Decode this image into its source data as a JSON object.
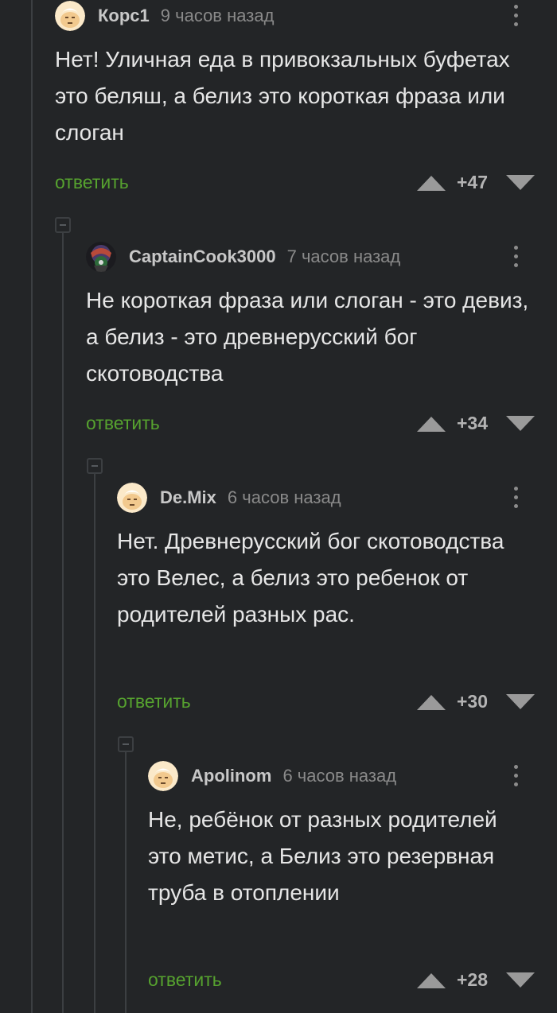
{
  "comments": [
    {
      "author": "Корс1",
      "time": "9 часов назад",
      "body": "Нет! Уличная еда в привокзальных буфетах это беляш, а белиз это короткая фраза или слоган",
      "reply_label": "ответить",
      "score": "+47",
      "avatar_icon": "default-avatar-icon"
    },
    {
      "author": "CaptainCook3000",
      "time": "7 часов назад",
      "body": "Не короткая фраза или слоган - это девиз, а белиз - это древнерусский бог скотоводства",
      "reply_label": "ответить",
      "score": "+34",
      "avatar_icon": "user-photo-avatar"
    },
    {
      "author": "De.Mix",
      "time": "6 часов назад",
      "body": "Нет. Древнерусский бог скотоводства это Велес, а белиз это ребенок от родителей разных рас.",
      "reply_label": "ответить",
      "score": "+30",
      "avatar_icon": "default-avatar-icon"
    },
    {
      "author": "Apolinom",
      "time": "6 часов назад",
      "body": "Не, ребёнок от разных родителей это метис, а Белиз это резервная труба в отоплении",
      "reply_label": "ответить",
      "score": "+28",
      "avatar_icon": "default-avatar-icon"
    }
  ],
  "colors": {
    "background": "#232527",
    "reply_link": "#56a22f",
    "thread_line": "#3c3f42",
    "text": "#e6e6e6",
    "meta": "#8a8a8a"
  }
}
